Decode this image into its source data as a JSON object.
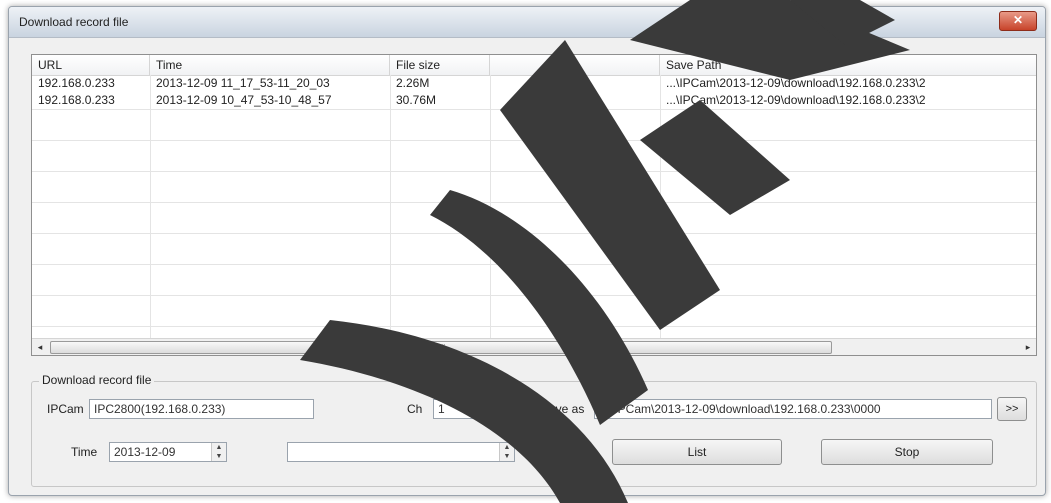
{
  "window": {
    "title": "Download record file",
    "close_label": "✕"
  },
  "table": {
    "columns": [
      "URL",
      "Time",
      "File size",
      "",
      "Save Path"
    ],
    "rows": [
      [
        "192.168.0.233",
        "2013-12-09 11_17_53-11_20_03",
        "2.26M",
        "",
        "...\\IPCam\\2013-12-09\\download\\192.168.0.233\\2"
      ],
      [
        "192.168.0.233",
        "2013-12-09 10_47_53-10_48_57",
        "30.76M",
        "",
        "...\\IPCam\\2013-12-09\\download\\192.168.0.233\\2"
      ]
    ]
  },
  "download": {
    "group_label": "Download record file",
    "ipcam_label": "IPCam",
    "ipcam_value": "IPC2800(192.168.0.233)",
    "channel_label": "Ch",
    "channel_value": "1",
    "save_label": "Save as",
    "save_path": "C:\\IPCam\\2013-12-09\\download\\192.168.0.233\\0000",
    "browse_label": ">>",
    "time_label": "Time",
    "time_value": "2013-12-09",
    "second_spin_value": "",
    "list_button_label": "List",
    "stop_button_label": "Stop"
  },
  "icons": {
    "scroll_left": "◂",
    "scroll_right": "▸",
    "dropdown": "▼",
    "spin_up": "▲",
    "spin_down": "▼",
    "scroll_grip": "|||"
  },
  "colors": {
    "watermark": "#3a3a3a",
    "close_button": "#c7432a"
  }
}
